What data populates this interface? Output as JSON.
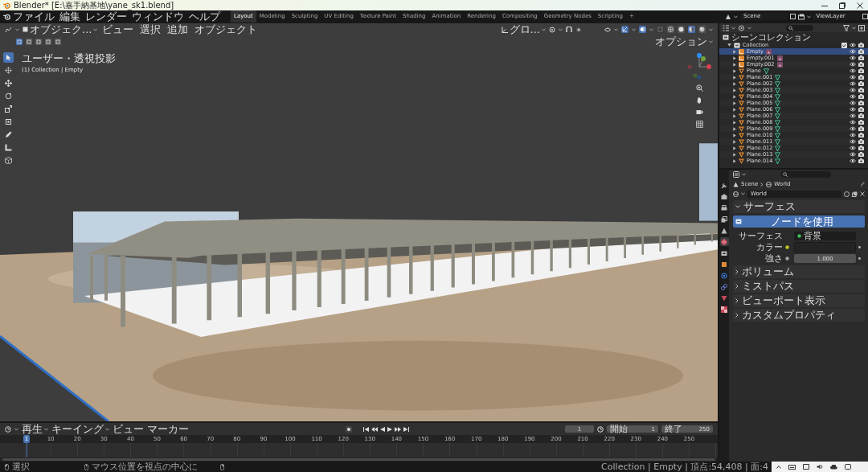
{
  "window": {
    "title": "Blender* [E:\\嘉手納基地\\yane_sk1.blend]"
  },
  "menu": [
    "ファイル",
    "編集",
    "レンダー",
    "ウィンドウ",
    "ヘルプ"
  ],
  "workspaces": [
    {
      "label": "Layout",
      "selected": true
    },
    {
      "label": "Modeling",
      "selected": false
    },
    {
      "label": "Sculpting",
      "selected": false
    },
    {
      "label": "UV Editing",
      "selected": false
    },
    {
      "label": "Texture Paint",
      "selected": false
    },
    {
      "label": "Shading",
      "selected": false
    },
    {
      "label": "Animation",
      "selected": false
    },
    {
      "label": "Rendering",
      "selected": false
    },
    {
      "label": "Compositing",
      "selected": false
    },
    {
      "label": "Geometry Nodes",
      "selected": false
    },
    {
      "label": "Scripting",
      "selected": false
    }
  ],
  "add_workspace": "+",
  "scene": "Scene",
  "view_layer": "ViewLayer",
  "viewport": {
    "mode": "オブジェク...",
    "menus": [
      "ビュー",
      "選択",
      "追加",
      "オブジェクト"
    ],
    "orientation": "グロ...",
    "options": "オプション",
    "view_name": "ユーザー・透視投影",
    "context": "(1) Collection | Empty",
    "select_modes": [
      {
        "selected": true
      },
      {
        "selected": false
      },
      {
        "selected": false
      },
      {
        "selected": false
      },
      {
        "selected": false
      }
    ],
    "shading": [
      {
        "kind": "wireframe",
        "selected": false
      },
      {
        "kind": "solid",
        "selected": false
      },
      {
        "kind": "material",
        "selected": true
      },
      {
        "kind": "rendered",
        "selected": false
      }
    ],
    "tools": [
      {
        "kind": "select",
        "selected": true
      },
      {
        "kind": "cursor",
        "selected": false
      },
      {
        "kind": "move",
        "selected": false
      },
      {
        "kind": "rotate",
        "selected": false
      },
      {
        "kind": "scale",
        "selected": false
      },
      {
        "kind": "transform",
        "selected": false
      },
      {
        "kind": "annotate",
        "selected": false
      },
      {
        "kind": "measure",
        "selected": false
      },
      {
        "kind": "add-cube",
        "selected": false
      }
    ]
  },
  "outliner": {
    "root": "シーンコレクション",
    "collections": [
      {
        "label": "Collection",
        "expanded": true,
        "children": [
          {
            "label": "Empty",
            "kind": "empty",
            "selected": true
          },
          {
            "label": "Empty.001",
            "kind": "empty",
            "selected": false
          },
          {
            "label": "Empty.002",
            "kind": "empty",
            "selected": false
          },
          {
            "label": "Plane",
            "kind": "mesh",
            "selected": false
          },
          {
            "label": "Plane.001",
            "kind": "mesh",
            "selected": false
          },
          {
            "label": "Plane.002",
            "kind": "mesh",
            "selected": false
          },
          {
            "label": "Plane.003",
            "kind": "mesh",
            "selected": false
          },
          {
            "label": "Plane.004",
            "kind": "mesh",
            "selected": false
          },
          {
            "label": "Plane.005",
            "kind": "mesh",
            "selected": false
          },
          {
            "label": "Plane.006",
            "kind": "mesh",
            "selected": false
          },
          {
            "label": "Plane.007",
            "kind": "mesh",
            "selected": false
          },
          {
            "label": "Plane.008",
            "kind": "mesh",
            "selected": false
          },
          {
            "label": "Plane.009",
            "kind": "mesh",
            "selected": false
          },
          {
            "label": "Plane.010",
            "kind": "mesh",
            "selected": false
          },
          {
            "label": "Plane.011",
            "kind": "mesh",
            "selected": false
          },
          {
            "label": "Plane.012",
            "kind": "mesh",
            "selected": false
          },
          {
            "label": "Plane.013",
            "kind": "mesh",
            "selected": false
          },
          {
            "label": "Plane.014",
            "kind": "mesh",
            "selected": false
          }
        ]
      }
    ]
  },
  "properties": {
    "tabs": [
      {
        "kind": "tool",
        "selected": false
      },
      {
        "kind": "render",
        "selected": false
      },
      {
        "kind": "output",
        "selected": false
      },
      {
        "kind": "view-layer",
        "selected": false
      },
      {
        "kind": "scene",
        "selected": false
      },
      {
        "kind": "world",
        "selected": true
      },
      {
        "kind": "collection",
        "selected": false
      },
      {
        "kind": "object",
        "selected": false
      },
      {
        "kind": "physics",
        "selected": false
      },
      {
        "kind": "constraints",
        "selected": false
      },
      {
        "kind": "data",
        "selected": false
      },
      {
        "kind": "texture",
        "selected": false
      }
    ],
    "breadcrumb": [
      "Scene",
      "World"
    ],
    "datablock": "World",
    "panels": [
      {
        "label": "サーフェス",
        "expanded": true
      },
      {
        "label": "ボリューム",
        "expanded": false
      },
      {
        "label": "ミストパス",
        "expanded": false
      },
      {
        "label": "ビューポート表示",
        "expanded": false
      },
      {
        "label": "カスタムプロパティ",
        "expanded": false
      }
    ],
    "surface": {
      "use_nodes": "ノードを使用",
      "surface_label": "サーフェス",
      "surface_value": "背景",
      "color_label": "カラー",
      "strength_label": "強さ",
      "strength": "1.000"
    }
  },
  "timeline": {
    "menus": [
      "再生",
      "キーイング",
      "ビュー",
      "マーカー"
    ],
    "current_frame": "1",
    "start_label": "開始",
    "start": "1",
    "end_label": "終了",
    "end": "250",
    "playhead": "1",
    "ticks": [
      "10",
      "20",
      "30",
      "40",
      "50",
      "60",
      "70",
      "80",
      "90",
      "100",
      "110",
      "120",
      "130",
      "140",
      "150",
      "160",
      "170",
      "180",
      "190",
      "200",
      "210",
      "220",
      "230",
      "240",
      "250"
    ]
  },
  "status": {
    "hints": [
      "選択",
      "マウス位置を視点の中心に"
    ],
    "info": "Collection | Empty | 頂点:54,408 | 面:4"
  }
}
